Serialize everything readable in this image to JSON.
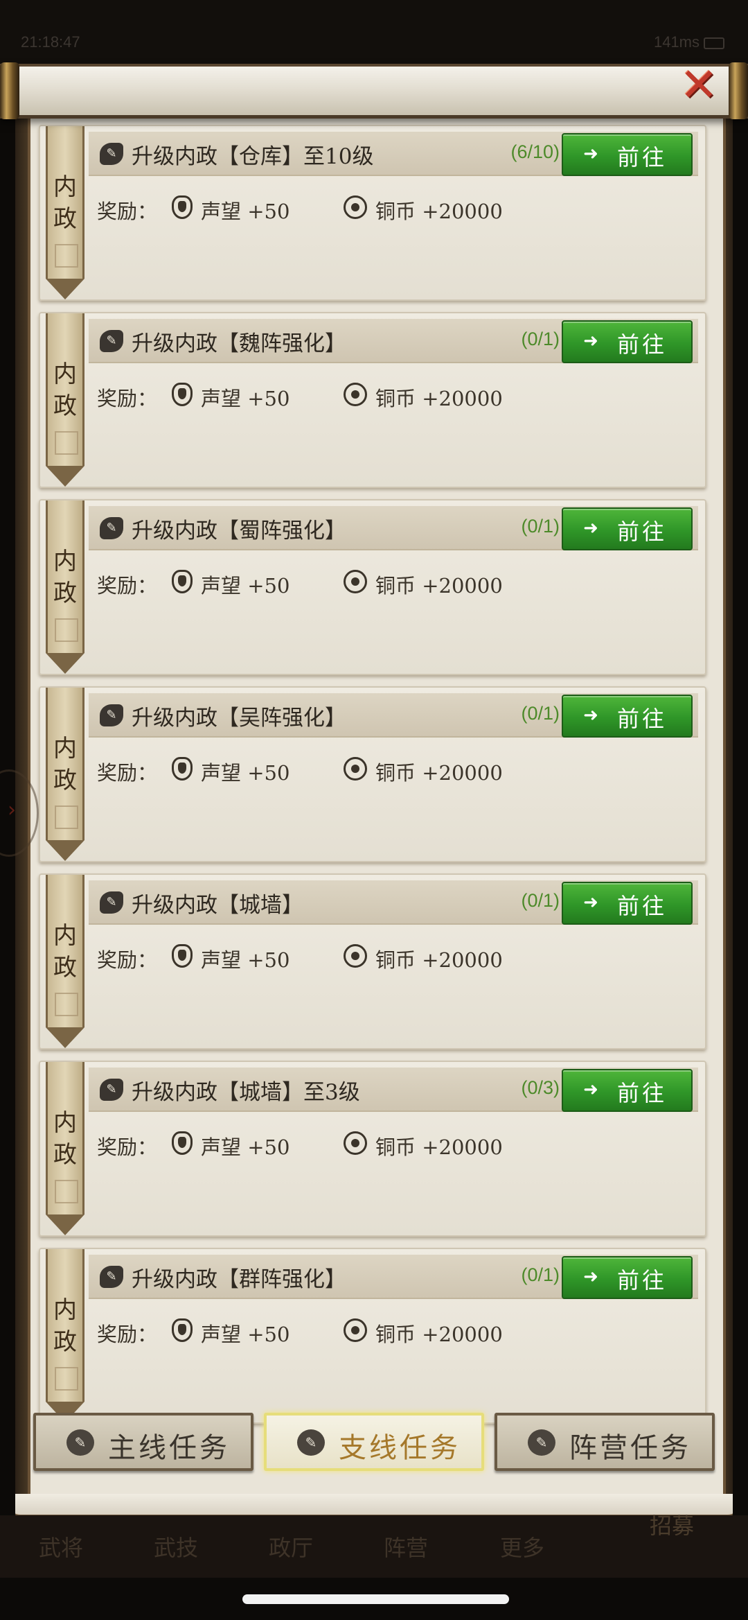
{
  "status": {
    "time": "21:18:47",
    "network": "141ms"
  },
  "ribbon_text": "内\n政",
  "tasks": [
    {
      "title": "升级内政【仓库】至10级",
      "progress": "(6/10)",
      "go_label": "前往",
      "reward_label": "奖励：",
      "reputation": "声望 +50",
      "coins": "铜币 +20000"
    },
    {
      "title": "升级内政【魏阵强化】",
      "progress": "(0/1)",
      "go_label": "前往",
      "reward_label": "奖励：",
      "reputation": "声望 +50",
      "coins": "铜币 +20000"
    },
    {
      "title": "升级内政【蜀阵强化】",
      "progress": "(0/1)",
      "go_label": "前往",
      "reward_label": "奖励：",
      "reputation": "声望 +50",
      "coins": "铜币 +20000"
    },
    {
      "title": "升级内政【吴阵强化】",
      "progress": "(0/1)",
      "go_label": "前往",
      "reward_label": "奖励：",
      "reputation": "声望 +50",
      "coins": "铜币 +20000"
    },
    {
      "title": "升级内政【城墙】",
      "progress": "(0/1)",
      "go_label": "前往",
      "reward_label": "奖励：",
      "reputation": "声望 +50",
      "coins": "铜币 +20000"
    },
    {
      "title": "升级内政【城墙】至3级",
      "progress": "(0/3)",
      "go_label": "前往",
      "reward_label": "奖励：",
      "reputation": "声望 +50",
      "coins": "铜币 +20000"
    },
    {
      "title": "升级内政【群阵强化】",
      "progress": "(0/1)",
      "go_label": "前往",
      "reward_label": "奖励：",
      "reputation": "声望 +50",
      "coins": "铜币 +20000"
    }
  ],
  "tabs": [
    {
      "label": "主线任务",
      "active": false
    },
    {
      "label": "支线任务",
      "active": true
    },
    {
      "label": "阵营任务",
      "active": false
    }
  ],
  "game_nav": [
    "武将",
    "武技",
    "政厅",
    "阵营",
    "更多"
  ],
  "recruit_label": "招募",
  "colors": {
    "go_button": "#2f9628",
    "progress_text": "#4d8a2a",
    "active_tab_text": "#a5782a",
    "close": "#c0392b"
  }
}
